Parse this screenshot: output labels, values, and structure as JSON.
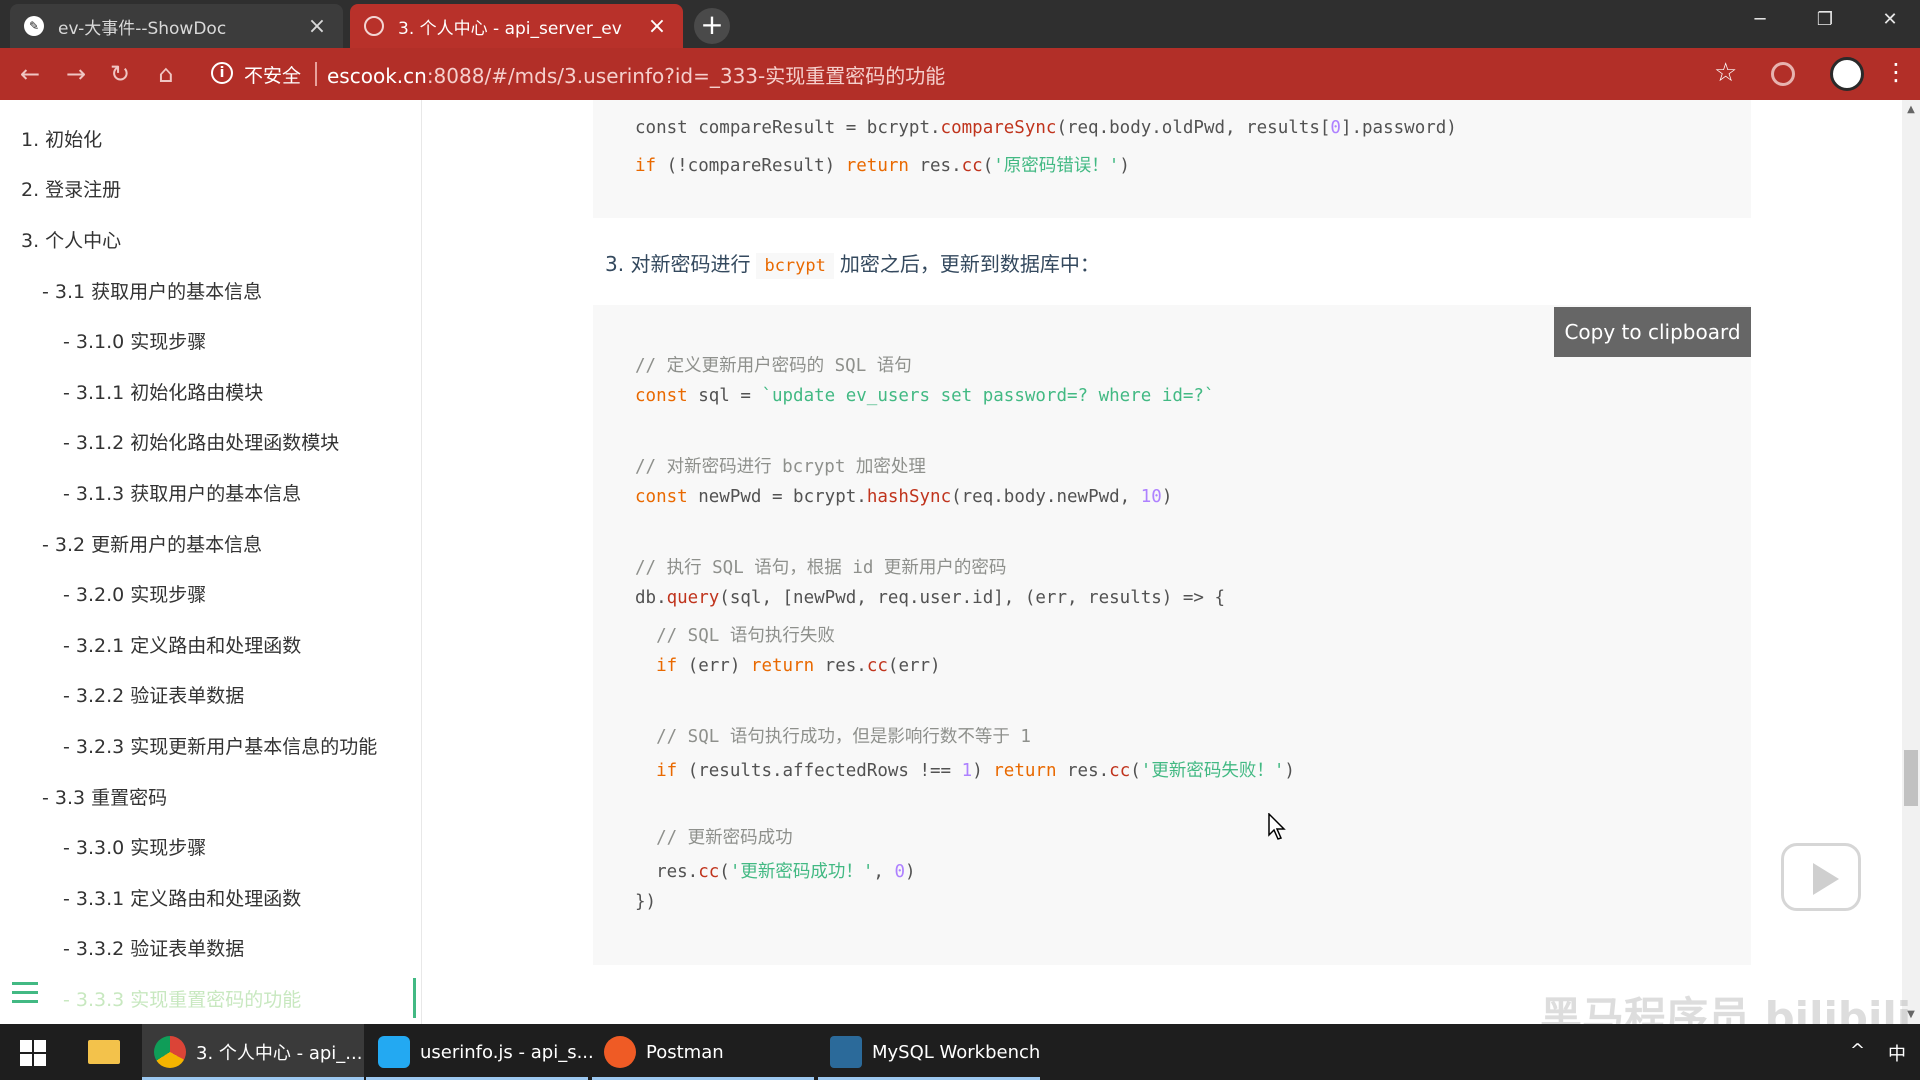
{
  "browser": {
    "tabs": [
      {
        "title": "ev-大事件--ShowDoc",
        "active": false
      },
      {
        "title": "3. 个人中心 - api_server_ev",
        "active": true
      }
    ],
    "security_label": "不安全",
    "url_host": "escook.cn",
    "url_rest": ":8088/#/mds/3.userinfo?id=_333-实现重置密码的功能",
    "theme_color": "#b22f28"
  },
  "sidebar": {
    "items": [
      {
        "label": "1. 初始化"
      },
      {
        "label": "2. 登录注册"
      },
      {
        "label": "3. 个人中心"
      },
      {
        "label": "- 3.1 获取用户的基本信息"
      },
      {
        "label": "- 3.1.0 实现步骤"
      },
      {
        "label": "- 3.1.1 初始化路由模块"
      },
      {
        "label": "- 3.1.2 初始化路由处理函数模块"
      },
      {
        "label": "- 3.1.3 获取用户的基本信息"
      },
      {
        "label": "- 3.2 更新用户的基本信息"
      },
      {
        "label": "- 3.2.0 实现步骤"
      },
      {
        "label": "- 3.2.1 定义路由和处理函数"
      },
      {
        "label": "- 3.2.2 验证表单数据"
      },
      {
        "label": "- 3.2.3 实现更新用户基本信息的功能"
      },
      {
        "label": "- 3.3 重置密码"
      },
      {
        "label": "- 3.3.0 实现步骤"
      },
      {
        "label": "- 3.3.1 定义路由和处理函数"
      },
      {
        "label": "- 3.3.2 验证表单数据"
      },
      {
        "label": "- 3.3.3 实现重置密码的功能"
      }
    ],
    "accent_color": "#42b983"
  },
  "content": {
    "code_top": {
      "line1_prefix": "const compareResult = bcrypt.",
      "line1_fn": "compareSync",
      "line1_args_a": "(req.body.oldPwd, results[",
      "line1_num": "0",
      "line1_args_b": "].password)",
      "line2_kw": "if",
      "line2_mid": " (!compareResult) ",
      "line2_ret": "return",
      "line2_obj": " res.",
      "line2_fn": "cc",
      "line2_open": "(",
      "line2_str": "'原密码错误！'",
      "line2_close": ")"
    },
    "step": {
      "prefix": "3. 对新密码进行",
      "code": "bcrypt",
      "suffix": "加密之后，更新到数据库中："
    },
    "copy_button": "Copy to clipboard",
    "code_main": {
      "c1": "// 定义更新用户密码的 SQL 语句",
      "l2_kw": "const",
      "l2_mid": " sql = ",
      "l2_str": "`update ev_users set password=? where id=?`",
      "c3": "// 对新密码进行 bcrypt 加密处理",
      "l4_kw": "const",
      "l4_mid": " newPwd = bcrypt.",
      "l4_fn": "hashSync",
      "l4_args": "(req.body.newPwd, ",
      "l4_num": "10",
      "l4_close": ")",
      "c5": "// 执行 SQL 语句，根据 id 更新用户的密码",
      "l6_obj": "db.",
      "l6_fn": "query",
      "l6_args": "(sql, [newPwd, req.user.id], (err, results) => {",
      "c7": "  // SQL 语句执行失败",
      "l8_kw": "  if",
      "l8_mid": " (err) ",
      "l8_ret": "return",
      "l8_obj": " res.",
      "l8_fn": "cc",
      "l8_args": "(err)",
      "c9": "  // SQL 语句执行成功，但是影响行数不等于 1",
      "l10_kw": "  if",
      "l10_mid": " (results.affectedRows !== ",
      "l10_num": "1",
      "l10_mid2": ") ",
      "l10_ret": "return",
      "l10_obj": " res.",
      "l10_fn": "cc",
      "l10_open": "(",
      "l10_str": "'更新密码失败！'",
      "l10_close": ")",
      "c11": "  // 更新密码成功",
      "l12_obj": "  res.",
      "l12_fn": "cc",
      "l12_open": "(",
      "l12_str": "'更新密码成功！'",
      "l12_mid": ", ",
      "l12_num": "0",
      "l12_close": ")",
      "l13": "})"
    }
  },
  "watermark": "黑马程序员 bilibili",
  "taskbar": {
    "items": [
      {
        "label": "3. 个人中心 - api_...",
        "icon": "chrome-icon",
        "active": true
      },
      {
        "label": "userinfo.js - api_s...",
        "icon": "vscode-icon",
        "active": false
      },
      {
        "label": "Postman",
        "icon": "postman-icon",
        "active": false
      },
      {
        "label": "MySQL Workbench",
        "icon": "mysql-workbench-icon",
        "active": false
      }
    ],
    "ime": "中"
  }
}
